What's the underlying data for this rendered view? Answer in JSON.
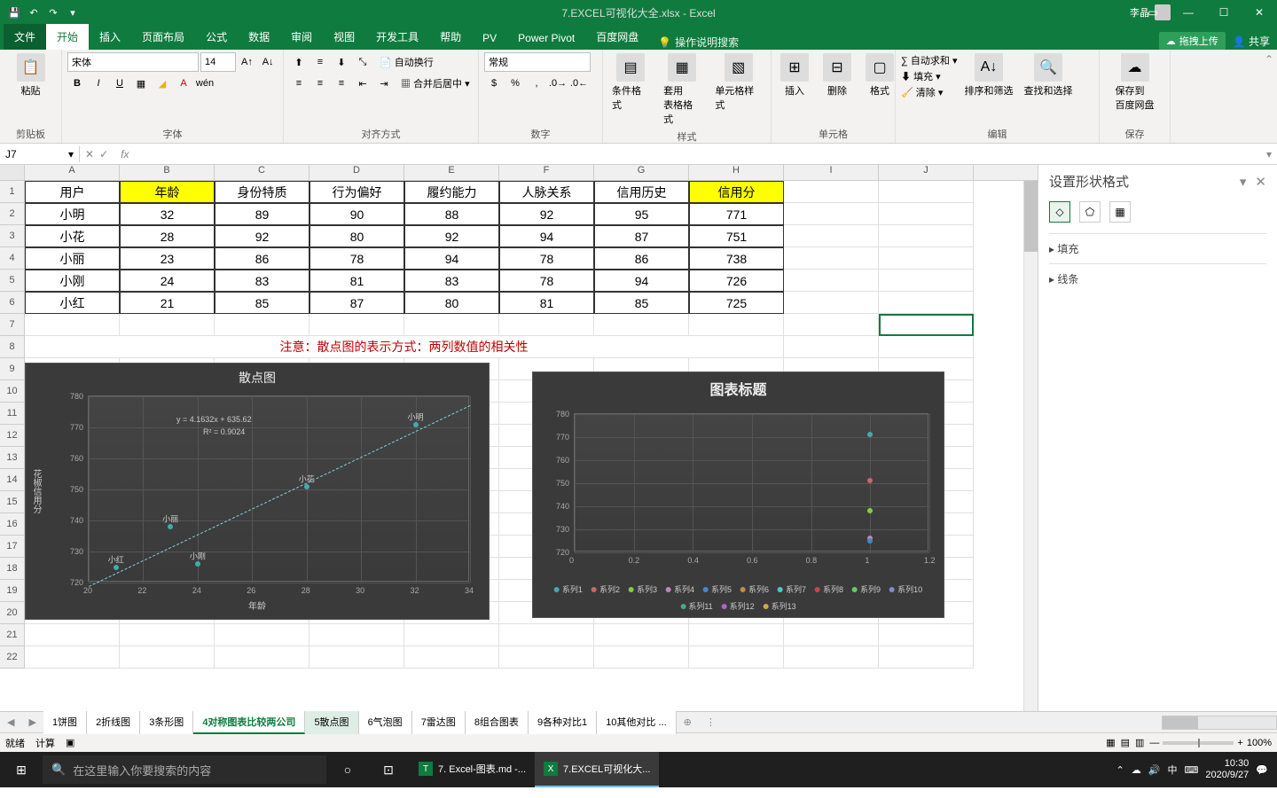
{
  "title": "7.EXCEL可视化大全.xlsx - Excel",
  "user": "李晶",
  "qat": {
    "save": "💾",
    "undo": "↶",
    "redo": "↷"
  },
  "tabs": {
    "file": "文件",
    "home": "开始",
    "insert": "插入",
    "layout": "页面布局",
    "formulas": "公式",
    "data": "数据",
    "review": "审阅",
    "view": "视图",
    "dev": "开发工具",
    "help": "帮助",
    "pv": "PV",
    "pp": "Power Pivot",
    "baidu": "百度网盘",
    "tellme": "操作说明搜索",
    "share": "共享",
    "upload": "拖拽上传"
  },
  "ribbon": {
    "clipboard": {
      "paste": "粘贴",
      "label": "剪贴板"
    },
    "font": {
      "name": "宋体",
      "size": "14",
      "label": "字体"
    },
    "align": {
      "wrap": "自动换行",
      "merge": "合并后居中",
      "label": "对齐方式"
    },
    "number": {
      "format": "常规",
      "label": "数字"
    },
    "styles": {
      "cond": "条件格式",
      "table": "套用\n表格格式",
      "cell": "单元格样式",
      "label": "样式"
    },
    "cells": {
      "insert": "插入",
      "delete": "删除",
      "format": "格式",
      "label": "单元格"
    },
    "editing": {
      "sum": "自动求和",
      "fill": "填充",
      "clear": "清除",
      "sort": "排序和筛选",
      "find": "查找和选择",
      "label": "编辑"
    },
    "save": {
      "baidu": "保存到\n百度网盘",
      "label": "保存"
    }
  },
  "namebox": "J7",
  "headers": [
    "A",
    "B",
    "C",
    "D",
    "E",
    "F",
    "G",
    "H",
    "I",
    "J"
  ],
  "table": {
    "cols": [
      "用户",
      "年龄",
      "身份特质",
      "行为偏好",
      "履约能力",
      "人脉关系",
      "信用历史",
      "信用分"
    ],
    "rows": [
      [
        "小明",
        "32",
        "89",
        "90",
        "88",
        "92",
        "95",
        "771"
      ],
      [
        "小花",
        "28",
        "92",
        "80",
        "92",
        "94",
        "87",
        "751"
      ],
      [
        "小丽",
        "23",
        "86",
        "78",
        "94",
        "78",
        "86",
        "738"
      ],
      [
        "小刚",
        "24",
        "83",
        "81",
        "83",
        "78",
        "94",
        "726"
      ],
      [
        "小红",
        "21",
        "85",
        "87",
        "80",
        "81",
        "85",
        "725"
      ]
    ]
  },
  "note": "注意：散点图的表示方式：两列数值的相关性",
  "chart_data": [
    {
      "type": "scatter",
      "title": "散点图",
      "xlabel": "年龄",
      "ylabel": "花椒信用分",
      "xlim": [
        20,
        34
      ],
      "ylim": [
        720,
        780
      ],
      "x_ticks": [
        20,
        22,
        24,
        26,
        28,
        30,
        32,
        34
      ],
      "y_ticks": [
        720,
        730,
        740,
        750,
        760,
        770,
        780
      ],
      "equation": "y = 4.1632x + 635.62",
      "r2": "R² = 0.9024",
      "series": [
        {
          "name": "小明",
          "x": 32,
          "y": 771
        },
        {
          "name": "小花",
          "x": 28,
          "y": 751
        },
        {
          "name": "小丽",
          "x": 23,
          "y": 738
        },
        {
          "name": "小刚",
          "x": 24,
          "y": 726
        },
        {
          "name": "小红",
          "x": 21,
          "y": 725
        }
      ]
    },
    {
      "type": "scatter",
      "title": "图表标题",
      "xlim": [
        0,
        1.2
      ],
      "ylim": [
        720,
        780
      ],
      "x_ticks": [
        0,
        0.2,
        0.4,
        0.6,
        0.8,
        1,
        1.2
      ],
      "y_ticks": [
        720,
        730,
        740,
        750,
        760,
        770,
        780
      ],
      "legend": [
        "系列1",
        "系列2",
        "系列3",
        "系列4",
        "系列5",
        "系列6",
        "系列7",
        "系列8",
        "系列9",
        "系列10",
        "系列11",
        "系列12",
        "系列13"
      ],
      "points": [
        {
          "x": 1,
          "y": 771
        },
        {
          "x": 1,
          "y": 751
        },
        {
          "x": 1,
          "y": 738
        },
        {
          "x": 1,
          "y": 726
        },
        {
          "x": 1,
          "y": 725
        }
      ]
    }
  ],
  "pane": {
    "title": "设置形状格式",
    "fill": "填充",
    "line": "线条"
  },
  "sheets": [
    "1饼图",
    "2折线图",
    "3条形图",
    "4对称图表比较两公司",
    "5散点图",
    "6气泡图",
    "7雷达图",
    "8组合图表",
    "9各种对比1",
    "10其他对比 ..."
  ],
  "active_sheet": "4对称图表比较两公司",
  "selected_sheet": "5散点图",
  "status": {
    "ready": "就绪",
    "calc": "计算",
    "zoom": "100%"
  },
  "taskbar": {
    "search": "在这里输入你要搜索的内容",
    "tasks": [
      {
        "icon": "T",
        "label": "7. Excel-图表.md -...",
        "active": false
      },
      {
        "icon": "X",
        "label": "7.EXCEL可视化大...",
        "active": true
      }
    ],
    "time": "10:30",
    "date": "2020/9/27"
  }
}
